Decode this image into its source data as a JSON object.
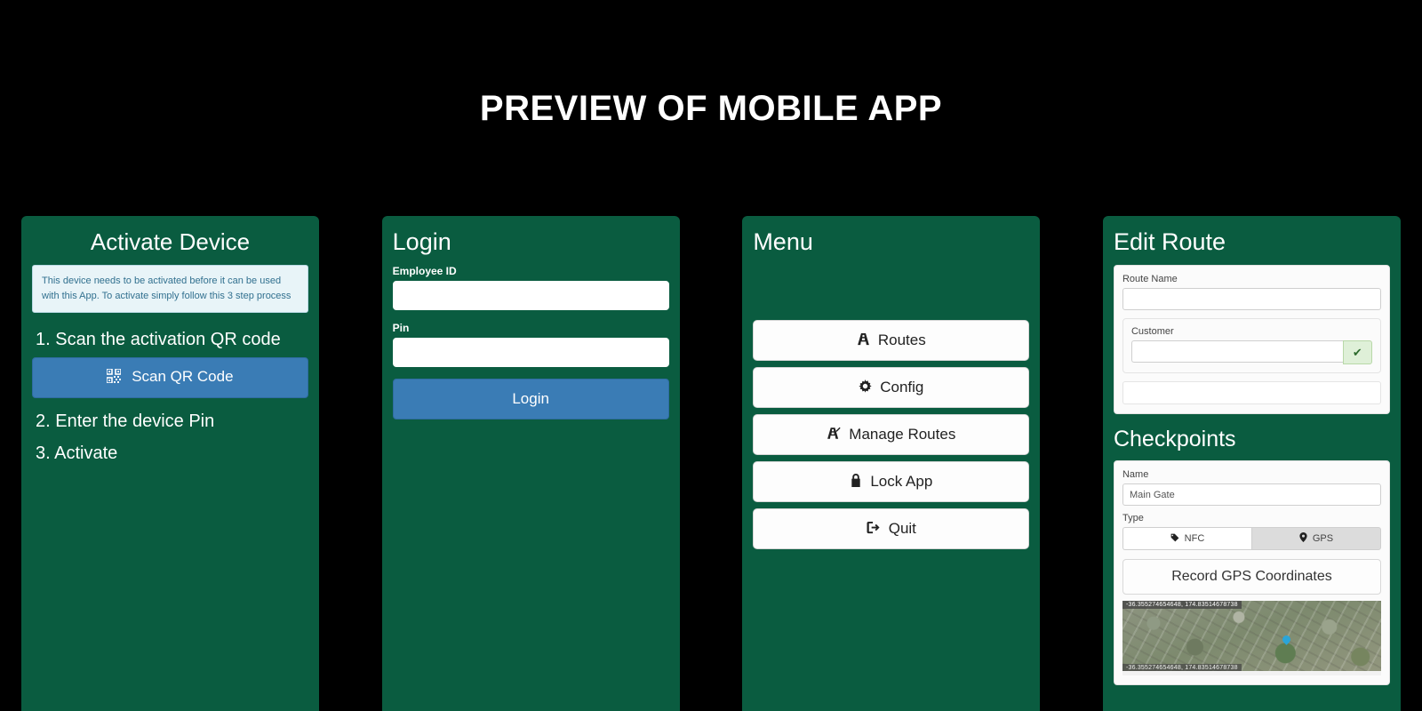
{
  "header": {
    "title": "PREVIEW OF MOBILE APP"
  },
  "colors": {
    "background": "#000000",
    "phone_bg": "#0a5c40",
    "primary_button": "#3a7cb5",
    "info_box": "#e8f4f8",
    "check_button": "#dff0d8"
  },
  "screens": [
    {
      "id": "activate-device",
      "title": "Activate Device",
      "info_text": "This device needs to be activated before it can be used with this App. To activate simply follow this 3 step process",
      "step1": "1. Scan the activation QR code",
      "scan_button": "Scan QR Code",
      "scan_icon": "qr-code-icon",
      "step2": "2. Enter the device Pin",
      "step3": "3. Activate"
    },
    {
      "id": "login",
      "title": "Login",
      "employee_label": "Employee ID",
      "employee_value": "",
      "pin_label": "Pin",
      "pin_value": "",
      "login_button": "Login"
    },
    {
      "id": "menu",
      "title": "Menu",
      "items": [
        {
          "label": "Routes",
          "icon": "road-icon"
        },
        {
          "label": "Config",
          "icon": "gear-icon"
        },
        {
          "label": "Manage Routes",
          "icon": "road-edit-icon"
        },
        {
          "label": "Lock App",
          "icon": "lock-icon"
        },
        {
          "label": "Quit",
          "icon": "sign-out-icon"
        }
      ]
    },
    {
      "id": "edit-route",
      "title": "Edit Route",
      "route_name_label": "Route Name",
      "route_name_value": "",
      "customer_label": "Customer",
      "customer_value": "",
      "confirm_icon": "check-icon",
      "checkpoints_title": "Checkpoints",
      "checkpoint_name_label": "Name",
      "checkpoint_name_value": "Main Gate",
      "type_label": "Type",
      "type_options": [
        {
          "label": "NFC",
          "icon": "tag-icon",
          "selected": false
        },
        {
          "label": "GPS",
          "icon": "map-pin-icon",
          "selected": true
        }
      ],
      "record_button": "Record GPS Coordinates",
      "coordinates": "-36.355274654648, 174.83514678738"
    }
  ]
}
